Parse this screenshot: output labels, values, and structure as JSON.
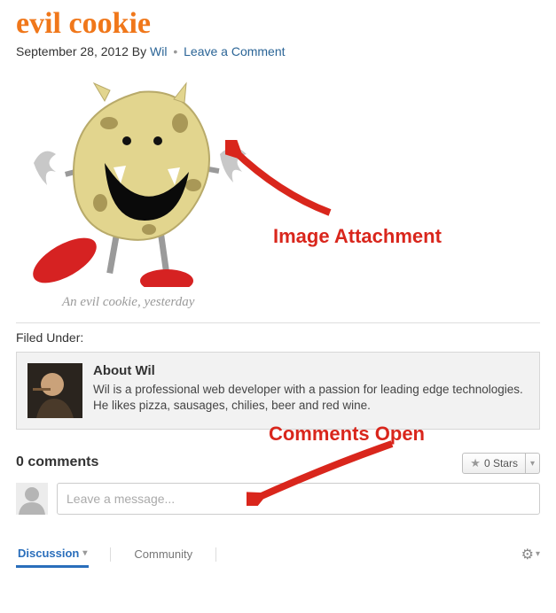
{
  "post": {
    "title": "evil cookie",
    "date": "September 28, 2012",
    "by_label": "By",
    "author": "Wil",
    "leave_comment": "Leave a Comment",
    "caption": "An evil cookie, yesterday"
  },
  "annotations": {
    "image_attachment": "Image Attachment",
    "comments_open": "Comments Open"
  },
  "filed": {
    "label": "Filed Under:"
  },
  "author_box": {
    "heading": "About Wil",
    "bio": "Wil is a professional web developer with a passion for leading edge technologies. He likes pizza, sausages, chilies, beer and red wine."
  },
  "comments": {
    "count_label": "0 comments",
    "stars_label": "0 Stars",
    "placeholder": "Leave a message..."
  },
  "tabs": {
    "discussion": "Discussion",
    "community": "Community"
  },
  "icons": {
    "star": "star-icon",
    "gear": "gear-icon",
    "chevron_down": "chevron-down-icon",
    "user": "user-silhouette-icon"
  },
  "colors": {
    "accent": "#f0771a",
    "link": "#2a6496",
    "annotation": "#d9261c",
    "tab_active": "#2a6ebb"
  }
}
